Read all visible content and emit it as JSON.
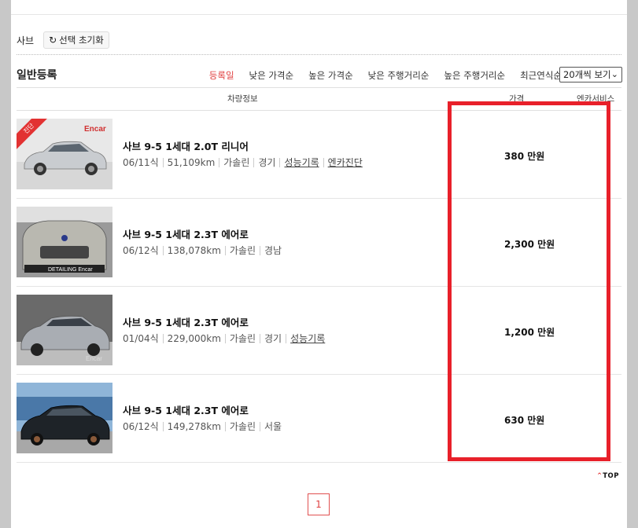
{
  "filter": {
    "label": "사브",
    "reset_label": "선택 초기화"
  },
  "list": {
    "title": "일반등록",
    "sort_tabs": [
      "등록일",
      "낮은 가격순",
      "높은 가격순",
      "낮은 주행거리순",
      "높은 주행거리순",
      "최근연식순"
    ],
    "view_select": "20개씩 보기",
    "columns": {
      "info": "차량정보",
      "price": "가격",
      "service": "엔카서비스"
    }
  },
  "listings": [
    {
      "title": "사브 9-5 1세대 2.0T 리니어",
      "year": "06/11식",
      "km": "51,109km",
      "fuel": "가솔린",
      "region": "경기",
      "links": [
        "성능기록",
        "엔카진단"
      ],
      "price": "380 만원",
      "badge": "진단",
      "photo_text": "Encar",
      "car_color": "#c9ccd0"
    },
    {
      "title": "사브 9-5 1세대 2.3T 에어로",
      "year": "06/12식",
      "km": "138,078km",
      "fuel": "가솔린",
      "region": "경남",
      "links": [],
      "price": "2,300 만원",
      "photo_text": "DETAILING Encar",
      "car_color": "#b9b8b0"
    },
    {
      "title": "사브 9-5 1세대 2.3T 에어로",
      "year": "01/04식",
      "km": "229,000km",
      "fuel": "가솔린",
      "region": "경기",
      "links": [
        "성능기록"
      ],
      "price": "1,200 만원",
      "photo_text": "Encar",
      "car_color": "#a9adb3"
    },
    {
      "title": "사브 9-5 1세대 2.3T 에어로",
      "year": "06/12식",
      "km": "149,278km",
      "fuel": "가솔린",
      "region": "서울",
      "links": [],
      "price": "630 만원",
      "car_color": "#1e2328"
    }
  ],
  "top_label": "TOP",
  "page_number": "1",
  "colors": {
    "accent": "#e04040",
    "highlight": "#e8202a"
  }
}
